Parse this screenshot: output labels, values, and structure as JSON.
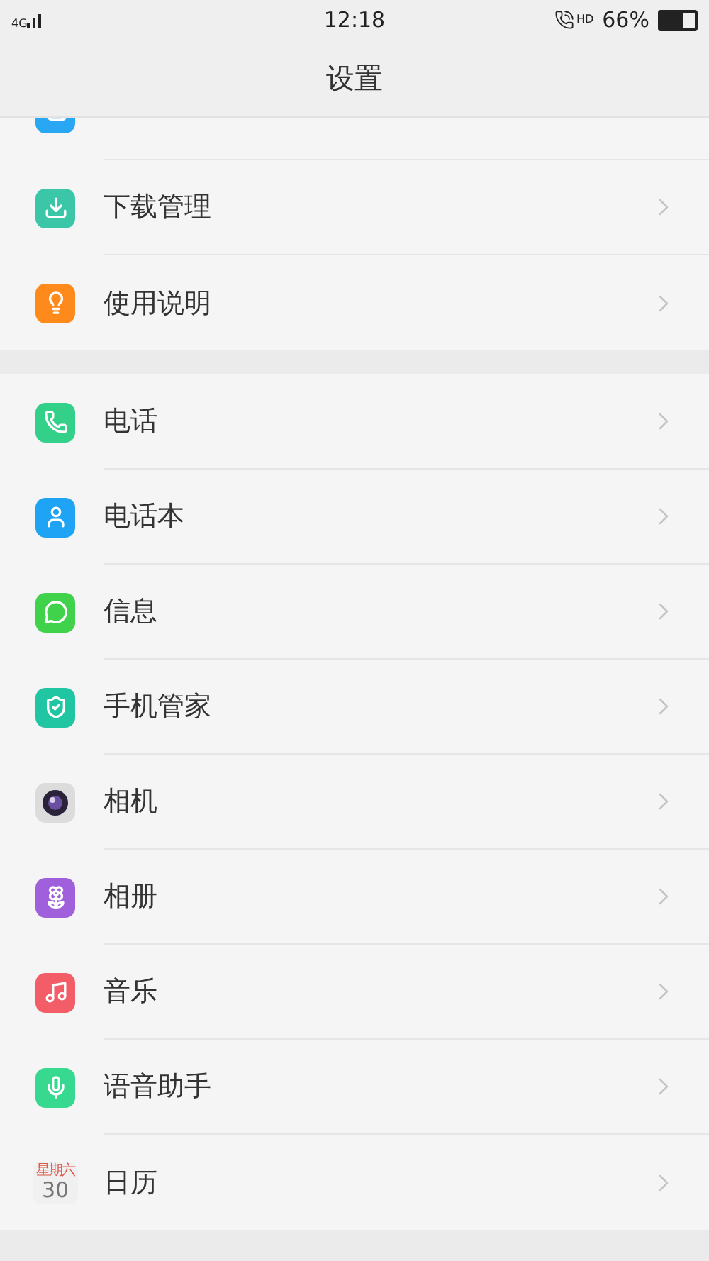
{
  "status_bar": {
    "network": "4G",
    "time": "12:18",
    "call_badge": "HD",
    "battery": "66%"
  },
  "title": "设置",
  "sections": [
    {
      "items": [
        {
          "kind": "cloud"
        },
        {
          "kind": "download",
          "label": "下载管理"
        },
        {
          "kind": "guide",
          "label": "使用说明"
        }
      ]
    },
    {
      "items": [
        {
          "kind": "phone",
          "label": "电话"
        },
        {
          "kind": "contacts",
          "label": "电话本"
        },
        {
          "kind": "messages",
          "label": "信息"
        },
        {
          "kind": "security",
          "label": "手机管家"
        },
        {
          "kind": "camera",
          "label": "相机"
        },
        {
          "kind": "gallery",
          "label": "相册"
        },
        {
          "kind": "music",
          "label": "音乐"
        },
        {
          "kind": "voice",
          "label": "语音助手"
        },
        {
          "kind": "calendar",
          "label": "日历",
          "weekday": "星期六",
          "day": "30"
        }
      ]
    }
  ]
}
